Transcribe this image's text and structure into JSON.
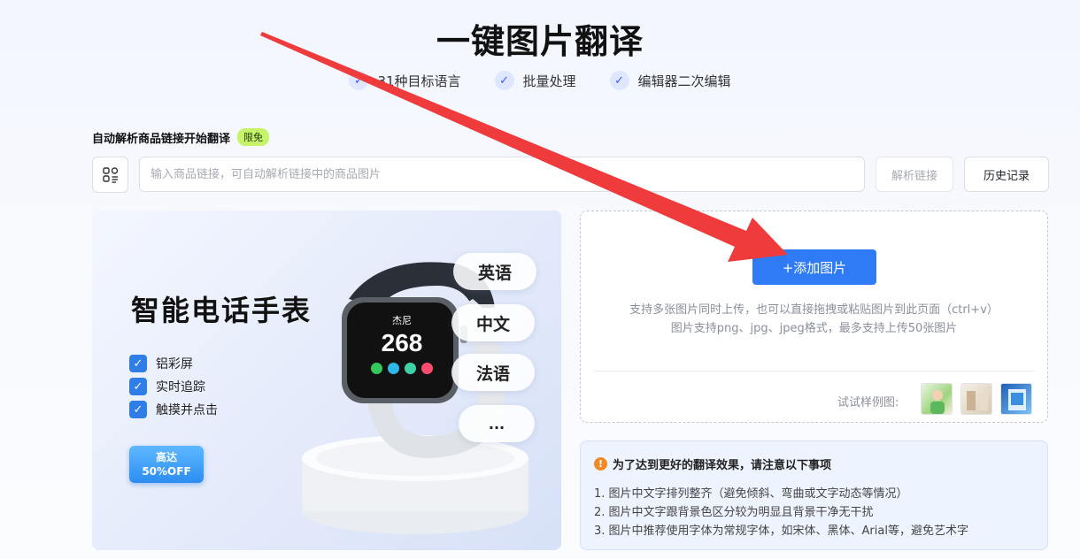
{
  "header": {
    "title": "一键图片翻译",
    "features": [
      {
        "icon": "check-icon",
        "label": "31种目标语言"
      },
      {
        "icon": "check-icon",
        "label": "批量处理"
      },
      {
        "icon": "check-icon",
        "label": "编辑器二次编辑"
      }
    ]
  },
  "link_parse": {
    "label": "自动解析商品链接开始翻译",
    "badge": "限免",
    "placeholder": "输入商品链接，可自动解析链接中的商品图片",
    "value": "",
    "parse_button": "解析链接",
    "history_button": "历史记录"
  },
  "promo": {
    "title": "智能电话手表",
    "features": [
      "铝彩屏",
      "实时追踪",
      "触摸并点击"
    ],
    "badge_line1": "高达",
    "badge_line2": "50%OFF",
    "watch_name": "杰尼",
    "watch_number": "268",
    "languages": [
      "英语",
      "中文",
      "法语",
      "..."
    ]
  },
  "upload": {
    "add_button": "+添加图片",
    "hint_line1": "支持多张图片同时上传，也可以直接拖拽或粘贴图片到此页面（ctrl+v）",
    "hint_line2": "图片支持png、jpg、jpeg格式，最多支持上传50张图片",
    "samples_label": "试试样例图:"
  },
  "tips": {
    "heading": "为了达到更好的翻译效果，请注意以下事项",
    "items": [
      "1. 图片中文字排列整齐（避免倾斜、弯曲或文字动态等情况）",
      "2. 图片中文字跟背景色区分较为明显且背景干净无干扰",
      "3. 图片中推荐使用字体为常规字体，如宋体、黑体、Arial等，避免艺术字"
    ]
  },
  "colors": {
    "primary": "#2f7bf6",
    "arrow": "#ef3b3b",
    "free_badge": "#c6f36a",
    "warning": "#f08a24"
  }
}
